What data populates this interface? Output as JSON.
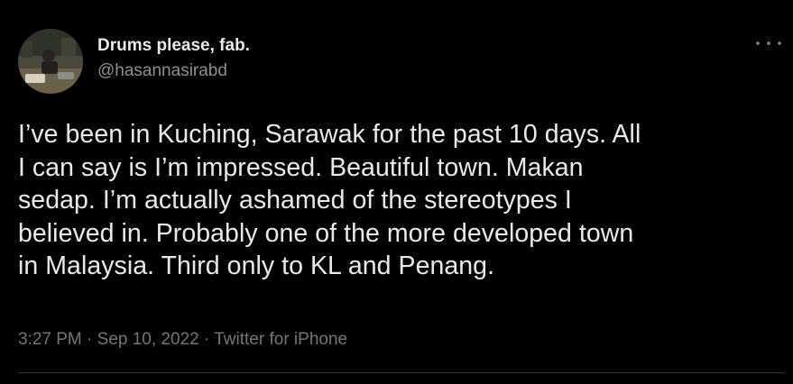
{
  "author": {
    "display_name": "Drums please, fab.",
    "handle": "@hasannasirabd",
    "avatar_icon": "profile-photo"
  },
  "menu": {
    "icon": "more-options-icon"
  },
  "tweet": {
    "lines": [
      "I’ve been in Kuching, Sarawak for the past 10 days. All",
      "I can say is I’m impressed. Beautiful town. Makan",
      "sedap. I’m actually ashamed of the stereotypes I",
      "believed in. Probably one of the more developed town",
      "in Malaysia. Third only to KL and Penang."
    ]
  },
  "meta": {
    "time": "3:27 PM",
    "separator1": " · ",
    "date": "Sep 10, 2022",
    "separator2": " · ",
    "source": "Twitter for iPhone"
  },
  "colors": {
    "background": "#000000",
    "primary_text": "#e7e9ea",
    "secondary_text": "#71767b",
    "divider": "#2f3336"
  }
}
